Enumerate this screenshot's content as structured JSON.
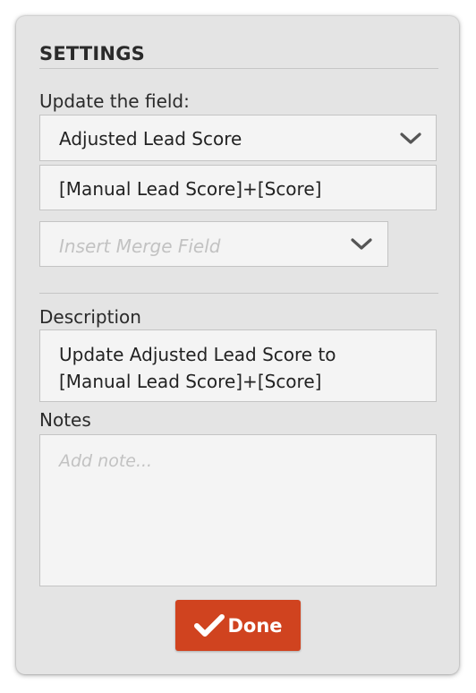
{
  "settings": {
    "heading": "SETTINGS",
    "update_field_label": "Update the field:",
    "field_select_value": "Adjusted Lead Score",
    "formula_value": "[Manual Lead Score]+[Score]",
    "merge_field_placeholder": "Insert Merge Field",
    "description_label": "Description",
    "description_line1": "Update Adjusted Lead Score to",
    "description_line2": "[Manual Lead Score]+[Score]",
    "notes_label": "Notes",
    "notes_placeholder": "Add note...",
    "done_label": "Done"
  },
  "icons": {
    "field_select": "chevron-down-icon",
    "merge_field": "chevron-down-icon",
    "done": "checkmark-icon"
  },
  "colors": {
    "panel_bg": "#e4e4e4",
    "input_bg": "#f4f4f4",
    "done_button": "#d0431f",
    "text": "#2a2a2a",
    "placeholder": "#c2c2c2"
  }
}
